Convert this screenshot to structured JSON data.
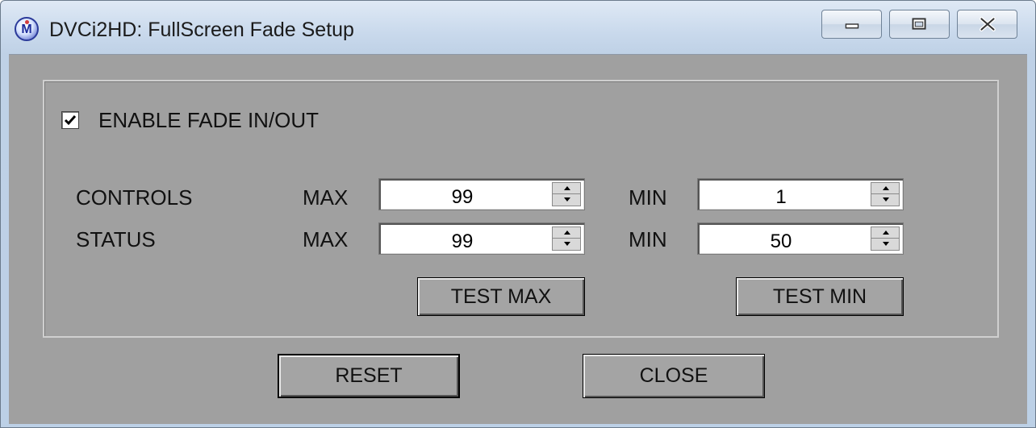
{
  "window": {
    "title": "DVCi2HD: FullScreen Fade Setup",
    "icon": "app-logo-m-icon"
  },
  "caption_buttons": {
    "minimize": "minimize-icon",
    "maximize": "maximize-icon",
    "close": "close-icon"
  },
  "fade": {
    "enable_label": "ENABLE FADE IN/OUT",
    "enabled": true
  },
  "rows": [
    {
      "label": "CONTROLS",
      "max_label": "MAX",
      "max_value": "99",
      "min_label": "MIN",
      "min_value": "1"
    },
    {
      "label": "STATUS",
      "max_label": "MAX",
      "max_value": "99",
      "min_label": "MIN",
      "min_value": "50"
    }
  ],
  "buttons": {
    "test_max": "TEST MAX",
    "test_min": "TEST MIN",
    "reset": "RESET",
    "close": "CLOSE"
  },
  "colors": {
    "dialog_background": "#a0a0a0",
    "title_bar": "#c9d9ec"
  }
}
